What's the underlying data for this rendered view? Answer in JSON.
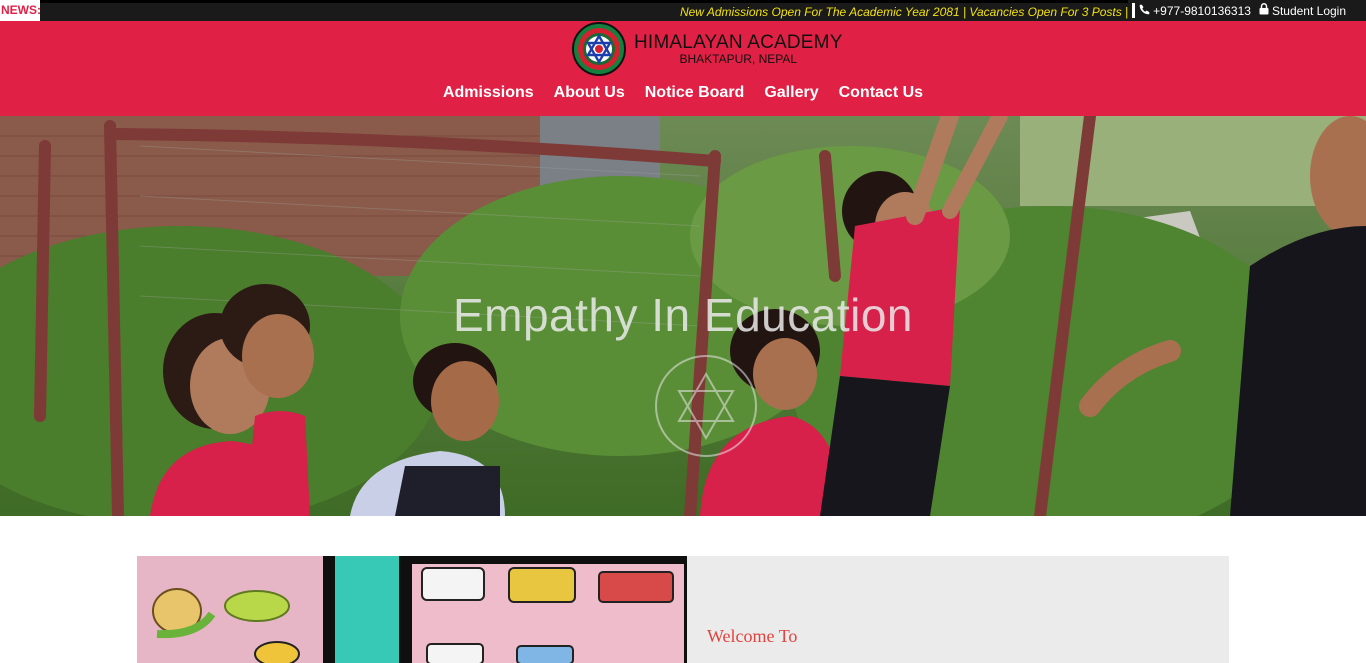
{
  "news": {
    "label": "NEWS:",
    "ticker": "New Admissions Open For The Academic Year 2081 | Vacancies Open For 3 Posts |",
    "phone": "+977-9810136313",
    "login": "Student Login",
    "ticker_color": "#f2e20c"
  },
  "brand": {
    "name": "HIMALAYAN ACADEMY",
    "place": "BHAKTAPUR, NEPAL",
    "header_color": "#e02145"
  },
  "nav": {
    "items": [
      "Admissions",
      "About Us",
      "Notice Board",
      "Gallery",
      "Contact Us"
    ]
  },
  "hero": {
    "title": "Empathy In Education"
  },
  "welcome": {
    "heading": "Welcome To",
    "heading_color": "#e0443f"
  },
  "icons": {
    "phone": "phone-icon",
    "lock": "lock-icon"
  }
}
